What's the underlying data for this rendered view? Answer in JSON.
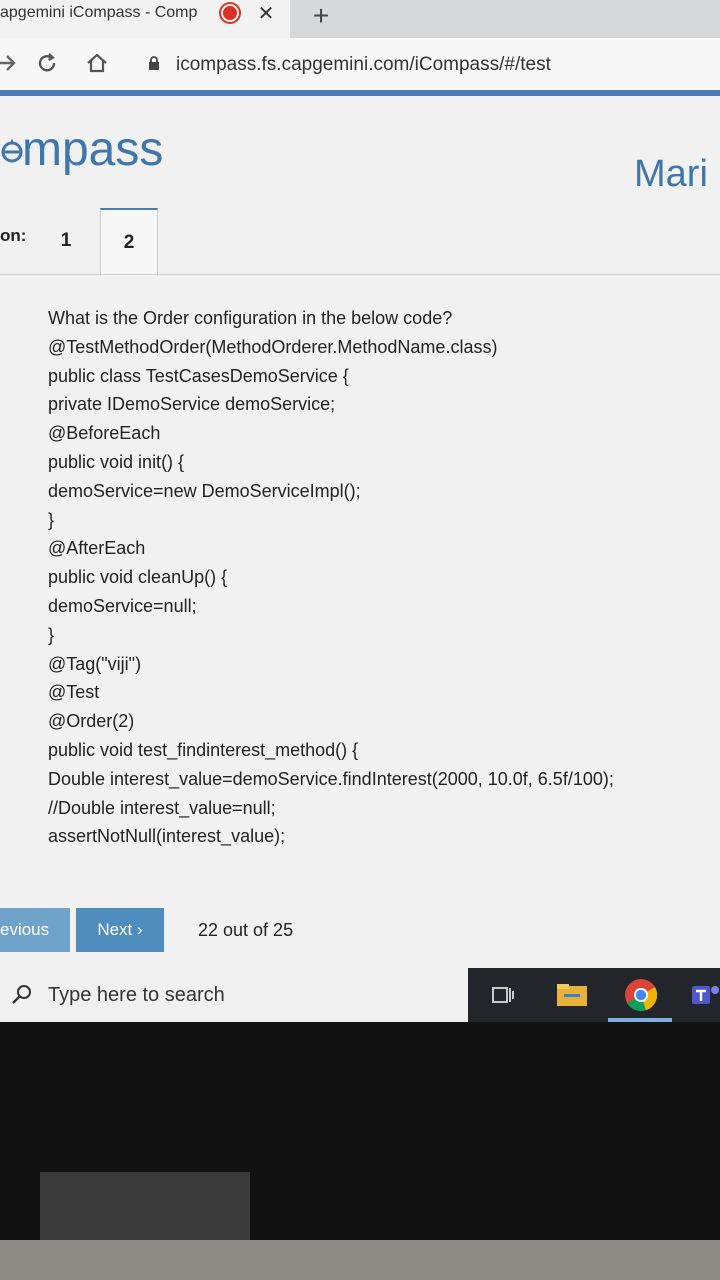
{
  "browser": {
    "tab_title": "apgemini iCompass - Comp",
    "address": "icompass.fs.capgemini.com/iCompass/#/test",
    "new_tab_symbol": "+",
    "close_symbol": "✕",
    "icons": {
      "back": "back-arrow-icon",
      "reload": "reload-icon",
      "home": "home-icon",
      "lock": "lock-icon",
      "recording": "recording-icon"
    }
  },
  "app": {
    "logo_text": "mpass",
    "user_name": "Mari",
    "accent_color": "#3f77ad"
  },
  "question_nav": {
    "label": "on:",
    "tabs": [
      {
        "label": "1",
        "active": false
      },
      {
        "label": "2",
        "active": true
      }
    ]
  },
  "question": {
    "lines": [
      "What is the Order configuration in the below code?",
      "@TestMethodOrder(MethodOrderer.MethodName.class)",
      "public class TestCasesDemoService {",
      "private IDemoService demoService;",
      "@BeforeEach",
      "public void init() {",
      "demoService=new DemoServiceImpl();",
      "}",
      "@AfterEach",
      "public void cleanUp() {",
      "demoService=null;",
      "}",
      "@Tag(\"viji\")",
      "@Test",
      "@Order(2)",
      "public void test_findinterest_method() {",
      "Double interest_value=demoService.findInterest(2000, 10.0f, 6.5f/100);",
      "//Double interest_value=null;",
      "assertNotNull(interest_value);"
    ]
  },
  "footer": {
    "previous_label": "evious",
    "next_label": "Next ›",
    "progress": "22 out of 25"
  },
  "taskbar": {
    "search_placeholder": "Type here to search",
    "icons": [
      "search-icon",
      "task-view-icon",
      "file-explorer-icon",
      "chrome-icon",
      "teams-icon"
    ]
  }
}
